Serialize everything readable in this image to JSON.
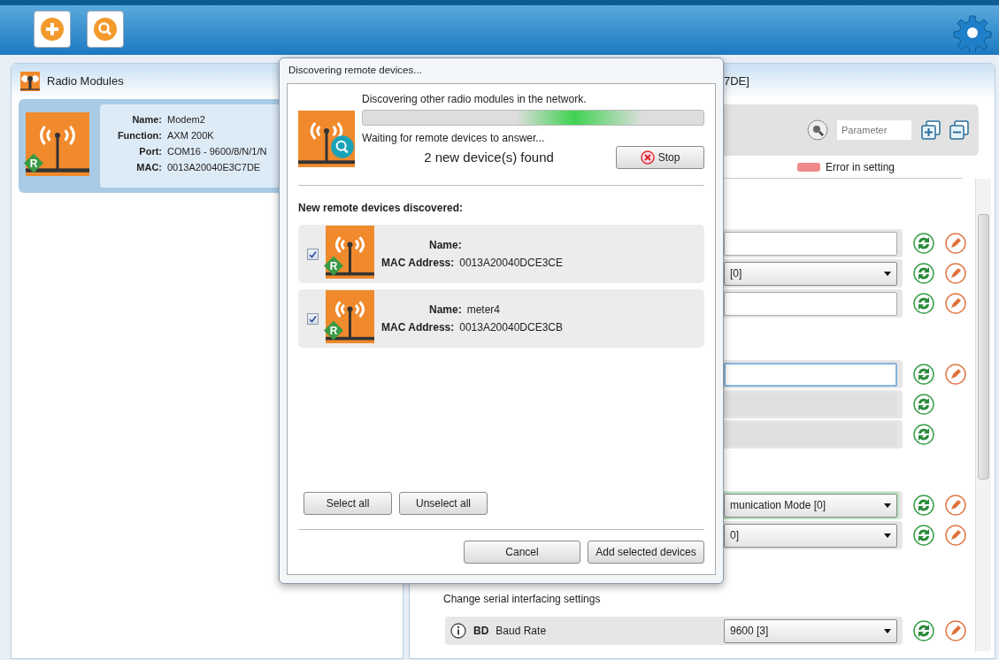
{
  "modules_panel": {
    "title": "Radio Modules",
    "modules": [
      {
        "selected": true,
        "badge": "R",
        "fields": [
          {
            "label": "Name:",
            "value": "Modem2"
          },
          {
            "label": "Function:",
            "value": "AXM 200K"
          },
          {
            "label": "Port:",
            "value": "COM16 - 9600/8/N/1/N"
          },
          {
            "label": "MAC:",
            "value": "0013A20040E3C7DE"
          }
        ]
      }
    ]
  },
  "config_panel": {
    "title": "7DE]",
    "search": {
      "placeholder": "Parameter"
    },
    "legend": "Error in setting",
    "groups": [
      {
        "rows": [
          {
            "kind": "text",
            "focused": false,
            "modified": false,
            "writable": true
          },
          {
            "kind": "select",
            "value": "[0]",
            "focused": false,
            "modified": false,
            "writable": true
          },
          {
            "kind": "text",
            "focused": false,
            "modified": false,
            "writable": true
          }
        ]
      },
      {
        "rows": [
          {
            "kind": "text",
            "focused": true,
            "modified": false,
            "writable": true
          },
          {
            "kind": "readonly",
            "focused": false,
            "modified": false,
            "writable": false
          },
          {
            "kind": "readonly",
            "focused": false,
            "modified": false,
            "writable": false
          }
        ]
      },
      {
        "rows": [
          {
            "kind": "select",
            "value": "munication Mode [0]",
            "focused": false,
            "modified": true,
            "writable": true
          },
          {
            "kind": "select",
            "value": "0]",
            "focused": false,
            "modified": false,
            "writable": true
          }
        ]
      },
      {
        "description": "Change serial interfacing settings",
        "rows": [
          {
            "kind": "select",
            "code": "BD",
            "label": "Baud Rate",
            "value": "9600 [3]",
            "focused": false,
            "modified": false,
            "writable": true
          }
        ]
      }
    ]
  },
  "dialog": {
    "title": "Discovering remote devices...",
    "status": "Discovering other radio modules in the network.",
    "progress": {
      "on": true
    },
    "substatus": "Waiting for remote devices to answer...",
    "found": "2 new device(s) found",
    "stop": "Stop",
    "list_title": "New remote devices discovered:",
    "devices": [
      {
        "checked": true,
        "badge": "R",
        "fields": [
          {
            "label": "Name:"
          },
          {
            "label": "MAC Address:",
            "value": "0013A20040DCE3CE"
          }
        ]
      },
      {
        "checked": true,
        "badge": "R",
        "fields": [
          {
            "label": "Name:",
            "value": "meter4"
          },
          {
            "label": "MAC Address:",
            "value": "0013A20040DCE3CB"
          }
        ]
      }
    ],
    "select_buttons": [
      "Select all",
      "Unselect all"
    ],
    "footer_buttons": [
      "Cancel",
      "Add selected devices"
    ]
  }
}
